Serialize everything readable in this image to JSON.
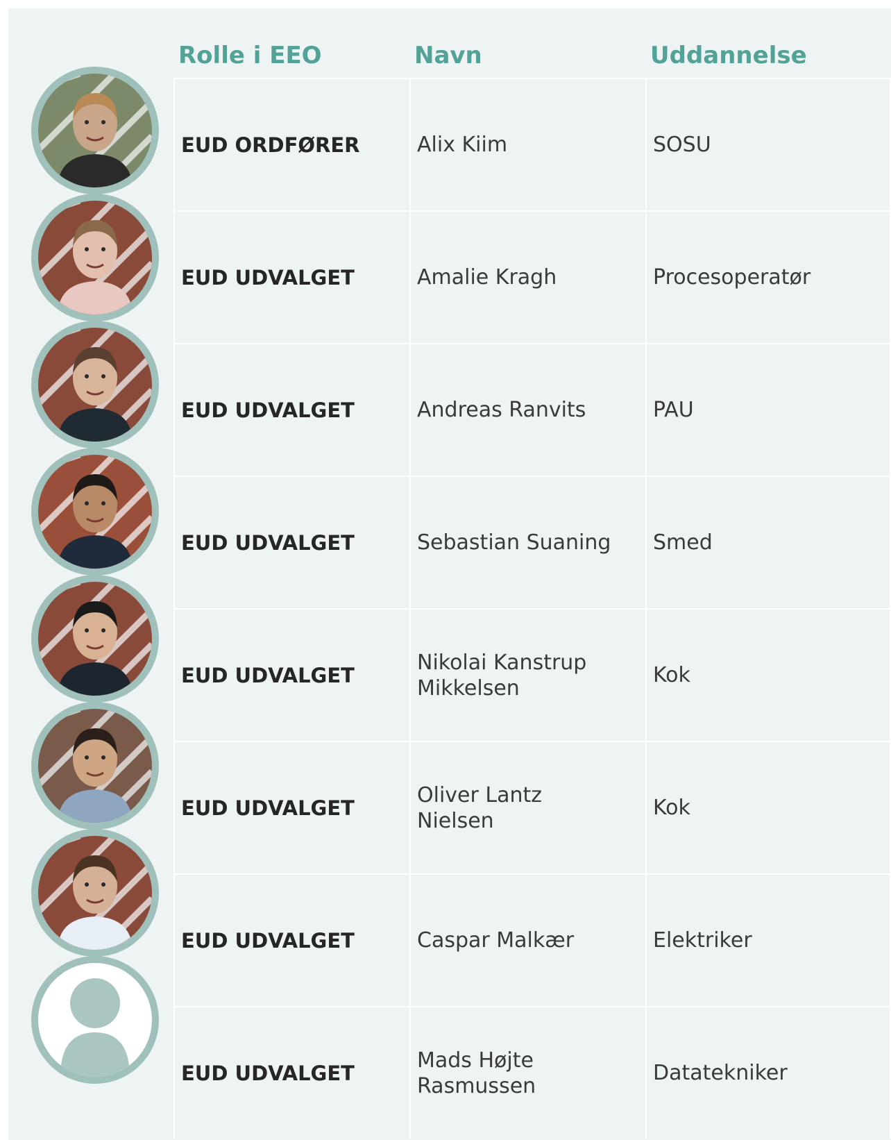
{
  "header": {
    "role": "Rolle i EEO",
    "name": "Navn",
    "education": "Uddannelse"
  },
  "rows": [
    {
      "role": "EUD ORDFØRER",
      "name": "Alix Kiim",
      "education": "SOSU"
    },
    {
      "role": "EUD UDVALGET",
      "name": "Amalie Kragh",
      "education": "Procesoperatør"
    },
    {
      "role": "EUD UDVALGET",
      "name": "Andreas Ranvits",
      "education": "PAU"
    },
    {
      "role": "EUD UDVALGET",
      "name": "Sebastian Suaning",
      "education": "Smed"
    },
    {
      "role": "EUD UDVALGET",
      "name": "Nikolai Kanstrup Mikkelsen",
      "education": "Kok"
    },
    {
      "role": "EUD UDVALGET",
      "name": "Oliver Lantz Nielsen",
      "education": "Kok"
    },
    {
      "role": "EUD UDVALGET",
      "name": "Caspar Malkær",
      "education": "Elektriker"
    },
    {
      "role": "EUD UDVALGET",
      "name": "Mads Højte Rasmussen",
      "education": "Datatekniker"
    }
  ],
  "colors": {
    "accent": "#52a297",
    "panel": "#eef4f3",
    "avatar_ring": "#9fc0bb"
  }
}
